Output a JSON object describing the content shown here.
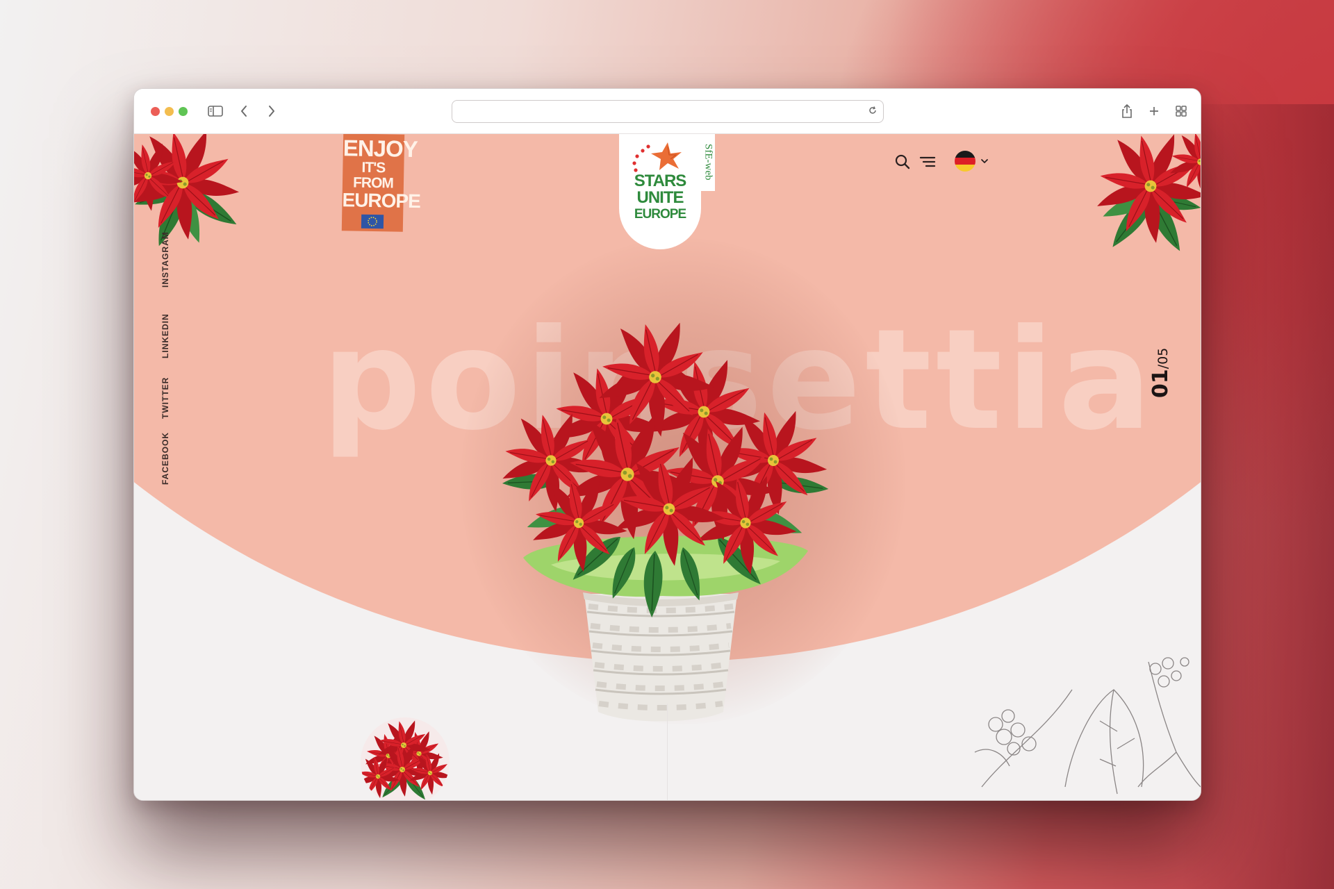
{
  "browser": {
    "address_value": "",
    "address_placeholder": "",
    "icons": [
      "sidebar-icon",
      "back-icon",
      "forward-icon",
      "reload-icon",
      "share-icon",
      "new-tab-icon",
      "tab-overview-icon"
    ]
  },
  "site": {
    "badge": {
      "line1": "ENJOY",
      "line2": "IT'S FROM",
      "line3": "EUROPE"
    },
    "logo": {
      "line1": "STARS",
      "line2": "UNITE",
      "line3": "EUROPE",
      "tab": "SfE-web"
    },
    "hero_word": "poinsettia",
    "slide_counter": {
      "current": "01",
      "total": "/05"
    },
    "social": [
      "FACEBOOK",
      "TWITTER",
      "LINKEDIN",
      "INSTAGRAM"
    ],
    "header_icons": [
      "search-icon",
      "menu-icon",
      "german-flag-icon"
    ],
    "colors": {
      "salmon": "#f4b9a8",
      "badge_orange": "#e07348",
      "logo_green": "#2e8a3c",
      "poinsettia_red": "#d8212a",
      "leaf_green": "#2f7a34"
    }
  }
}
